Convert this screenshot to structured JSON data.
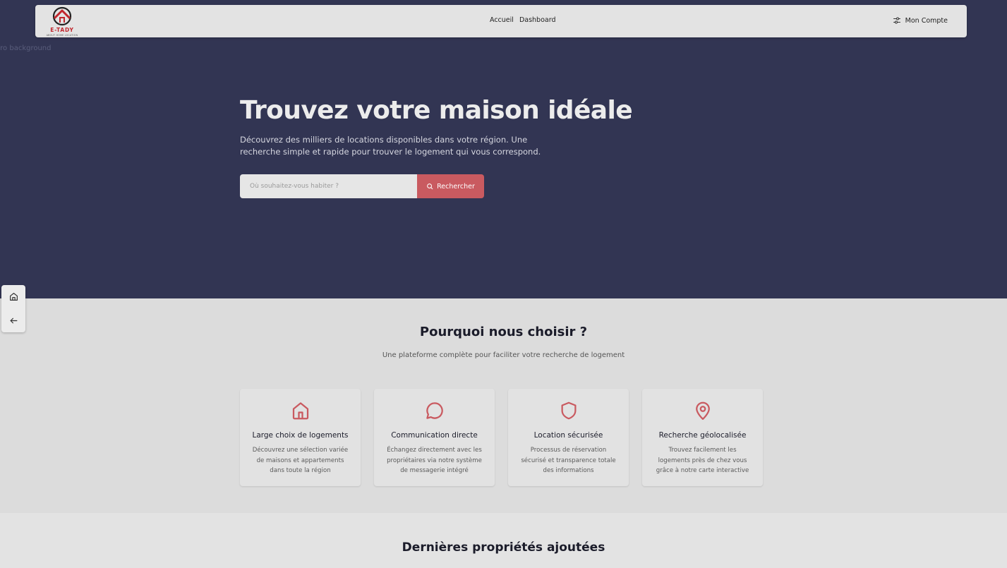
{
  "nav": {
    "logo_text": "E-TADY",
    "logo_tagline": "ABOUT HOME LOCATION",
    "links": [
      "Accueil",
      "Dashboard"
    ],
    "account_label": "Mon Compte",
    "account_icon": "settings-sliders-icon"
  },
  "hero": {
    "bg_alt": "ero background",
    "title": "Trouvez votre maison idéale",
    "subtitle": "Découvrez des milliers de locations disponibles dans votre région. Une recherche simple et rapide pour trouver le logement qui vous correspond.",
    "search_placeholder": "Où souhaitez-vous habiter ?",
    "search_button": "Rechercher"
  },
  "side_tools": [
    "home-icon",
    "arrow-left-icon"
  ],
  "features": {
    "title": "Pourquoi nous choisir ?",
    "subtitle": "Une plateforme complète pour faciliter votre recherche de logement",
    "cards": [
      {
        "icon": "house-icon",
        "title": "Large choix de logements",
        "desc": "Découvrez une sélection variée de maisons et appartements dans toute la région"
      },
      {
        "icon": "chat-bubble-icon",
        "title": "Communication directe",
        "desc": "Échangez directement avec les propriétaires via notre système de messagerie intégré"
      },
      {
        "icon": "shield-icon",
        "title": "Location sécurisée",
        "desc": "Processus de réservation sécurisé et transparence totale des informations"
      },
      {
        "icon": "map-pin-icon",
        "title": "Recherche géolocalisée",
        "desc": "Trouvez facilement les logements près de chez vous grâce à notre carte interactive"
      }
    ]
  },
  "latest": {
    "title": "Dernières propriétés ajoutées"
  },
  "colors": {
    "hero_bg": "#323553",
    "accent": "#c95a60",
    "page_bg": "#dcdcdc"
  }
}
